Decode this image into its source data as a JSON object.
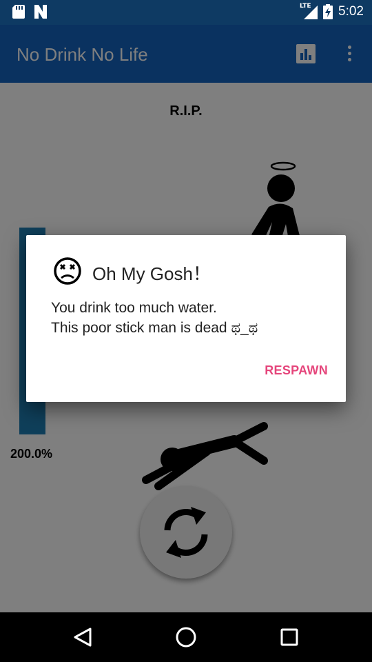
{
  "status_bar": {
    "time": "5:02",
    "network": "LTE"
  },
  "app_bar": {
    "title": "No Drink No Life",
    "chart_icon": "bar-chart-icon",
    "menu_icon": "more-vert-icon"
  },
  "main": {
    "rip_text": "R.I.P.",
    "meter_label": "200.0%",
    "meter_level_percent": 200.0,
    "refresh_icon": "refresh-icon"
  },
  "dialog": {
    "icon": "dizzy-face-icon",
    "title": "Oh My Gosh！",
    "message_line1": "You drink too much water.",
    "message_line2": "This poor stick man is dead ಥ_ಥ",
    "respawn_label": "RESPAWN"
  },
  "colors": {
    "primary": "#1565c0",
    "status_bar": "#0e3a63",
    "accent": "#e5457b",
    "meter": "#2e97cc"
  },
  "nav_bar": {
    "back_icon": "back-triangle-icon",
    "home_icon": "home-circle-icon",
    "recents_icon": "recents-square-icon"
  }
}
